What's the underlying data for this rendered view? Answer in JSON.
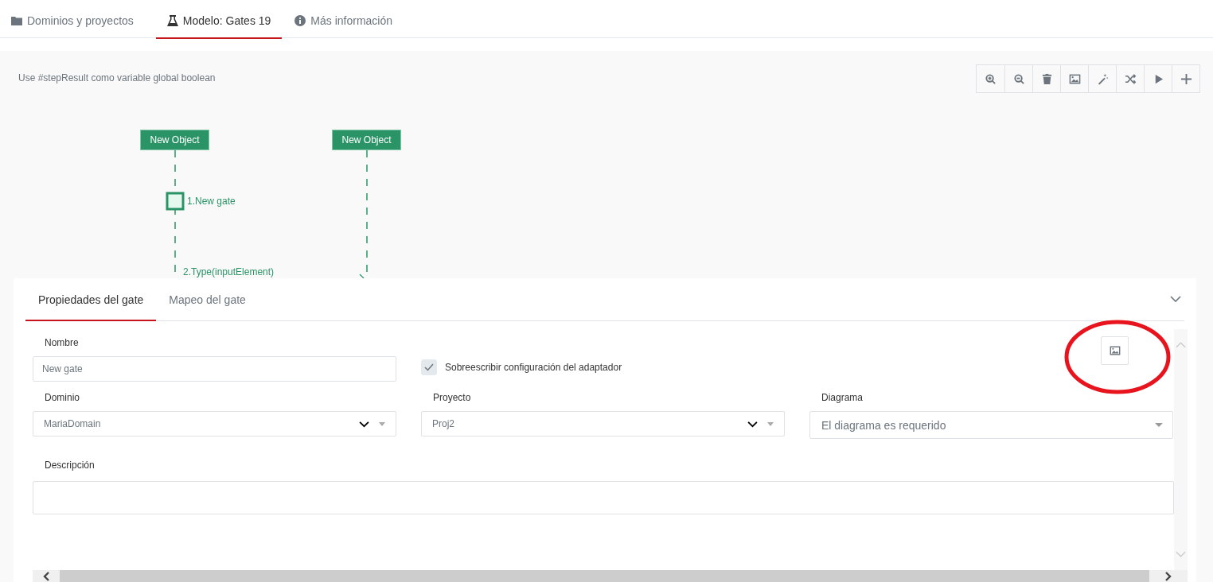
{
  "tabs": [
    {
      "label": "Dominios y proyectos",
      "selected": false
    },
    {
      "label": "Modelo: Gates 19",
      "selected": true
    },
    {
      "label": "Más información",
      "selected": false
    }
  ],
  "canvas": {
    "hint": "Use #stepResult como variable global boolean",
    "objects": [
      {
        "label": "New Object"
      },
      {
        "label": "New Object"
      }
    ],
    "messages": [
      {
        "label": "1.New gate",
        "kind": "self"
      },
      {
        "label": "2.Type(inputElement)",
        "kind": "call"
      }
    ]
  },
  "panel": {
    "tabs": [
      {
        "label": "Propiedades del gate",
        "selected": true
      },
      {
        "label": "Mapeo del gate",
        "selected": false
      }
    ],
    "nombre": {
      "label": "Nombre",
      "value": "New gate"
    },
    "override": {
      "label": "Sobreescribir configuración del adaptador",
      "checked": true
    },
    "selects": [
      {
        "label": "Dominio",
        "value": "MariaDomain",
        "kind": "native"
      },
      {
        "label": "Proyecto",
        "value": "Proj2",
        "kind": "native"
      },
      {
        "label": "Diagrama",
        "placeholder": "El diagrama es requerido",
        "kind": "custom"
      }
    ],
    "descripcion": {
      "label": "Descripción"
    }
  }
}
